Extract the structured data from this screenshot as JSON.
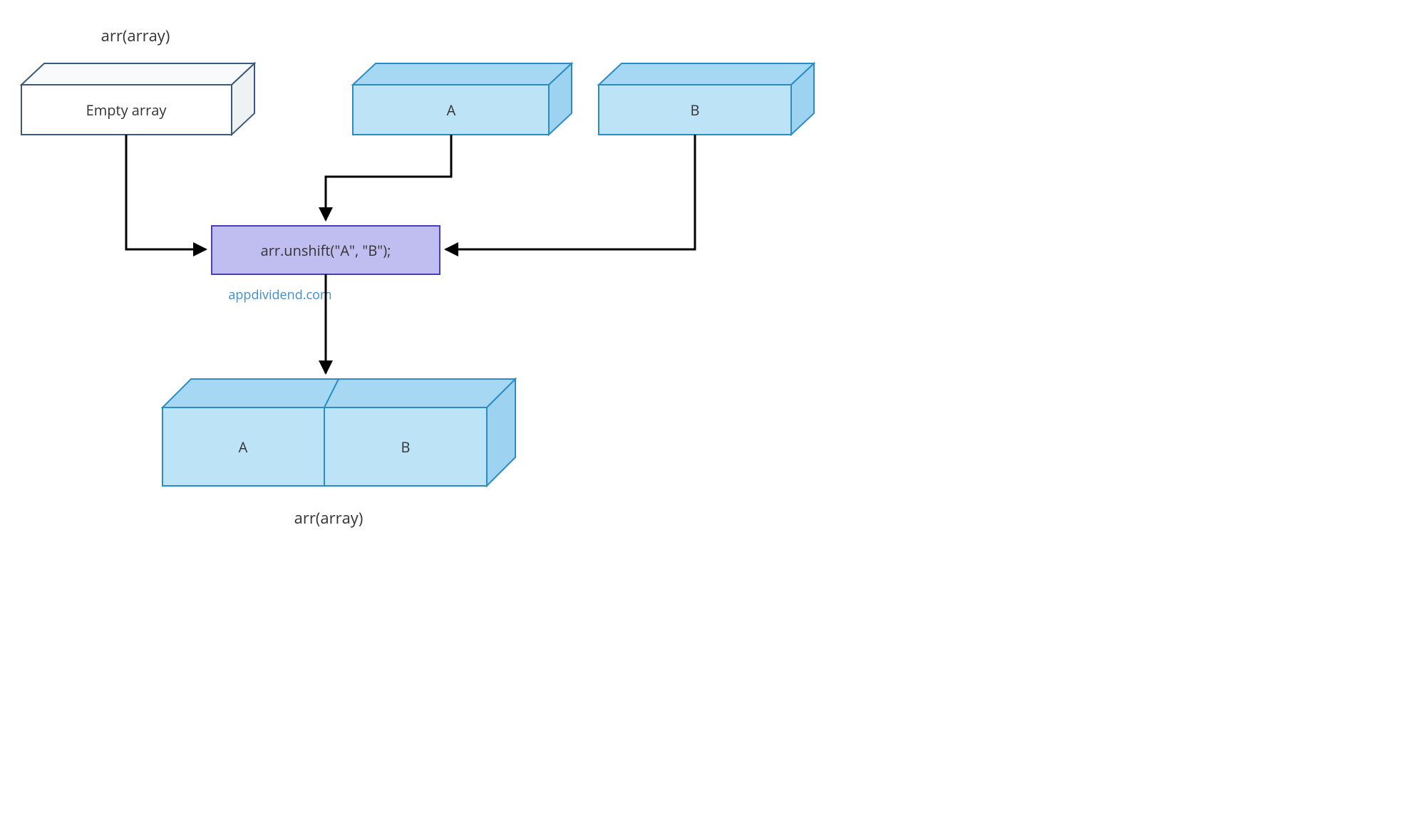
{
  "title_top": "arr(array)",
  "title_bottom": "arr(array)",
  "empty_box_label": "Empty array",
  "input_a_label": "A",
  "input_b_label": "B",
  "operation_label": "arr.unshift(\"A\", \"B\");",
  "watermark": "appdividend.com",
  "result_a_label": "A",
  "result_b_label": "B",
  "colors": {
    "empty_stroke": "#3c5a78",
    "empty_fill": "#f8fafb",
    "blue_stroke": "#2b8cc4",
    "blue_fill_light": "#bde3f7",
    "blue_fill_top": "#a6d8f4",
    "op_stroke": "#4a3fb5",
    "op_fill": "#c0bdf1",
    "arrow": "#000000"
  }
}
